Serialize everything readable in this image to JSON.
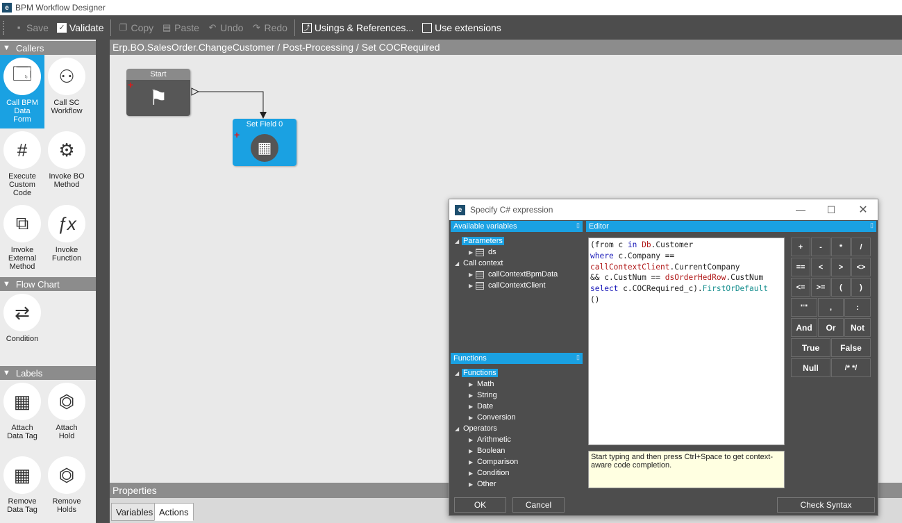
{
  "window": {
    "title": "BPM Workflow Designer",
    "logo": "e"
  },
  "toolbar": {
    "save": "Save",
    "validate": "Validate",
    "copy": "Copy",
    "paste": "Paste",
    "undo": "Undo",
    "redo": "Redo",
    "usings": "Usings & References...",
    "extensions": "Use extensions"
  },
  "toolbox": {
    "callers": {
      "header": "Callers",
      "items": [
        "Call BPM Data Form",
        "Call SC Workflow",
        "Execute Custom Code",
        "Invoke BO Method",
        "Invoke External Method",
        "Invoke Function"
      ]
    },
    "flowchart": {
      "header": "Flow Chart",
      "items": [
        "Condition"
      ]
    },
    "labels": {
      "header": "Labels",
      "items": [
        "Attach Data Tag",
        "Attach Hold",
        "Remove Data Tag",
        "Remove Holds"
      ]
    }
  },
  "breadcrumb": "Erp.BO.SalesOrder.ChangeCustomer / Post-Processing / Set COCRequired",
  "canvas": {
    "nodes": {
      "start": "Start",
      "set_field": "Set Field 0"
    }
  },
  "properties": {
    "header": "Properties",
    "tabs": [
      "Variables",
      "Actions"
    ],
    "active_tab": "Actions"
  },
  "dialog": {
    "logo": "e",
    "title": "Specify C# expression",
    "variables": {
      "header": "Available variables",
      "parameters": "Parameters",
      "ds": "ds",
      "call_context": "Call context",
      "bpm_data": "callContextBpmData",
      "client": "callContextClient"
    },
    "functions": {
      "header": "Functions",
      "root": "Functions",
      "items": [
        "Math",
        "String",
        "Date",
        "Conversion"
      ],
      "operators": "Operators",
      "operator_items": [
        "Arithmetic",
        "Boolean",
        "Comparison",
        "Condition",
        "Other"
      ]
    },
    "editor": {
      "header": "Editor",
      "code": {
        "l1": [
          "(from c ",
          "in",
          " ",
          "Db",
          ".Customer"
        ],
        "l2": [
          "where",
          " c.Company =="
        ],
        "l3": [
          "callContextClient",
          ".CurrentCompany"
        ],
        "l4": [
          "&& c.CustNum == ",
          "dsOrderHedRow",
          ".CustNum"
        ],
        "l5": [
          "select",
          " c.COCRequired_c).",
          "FirstOrDefault"
        ],
        "l6": "()"
      },
      "hint": "Start typing and then press Ctrl+Space to get context-aware code completion."
    },
    "keypad": {
      "row1": [
        "+",
        "-",
        "*",
        "/"
      ],
      "row2": [
        "==",
        "<",
        ">",
        "<>"
      ],
      "row3": [
        "<=",
        ">=",
        "(",
        ")"
      ],
      "row4": [
        "\"\"",
        ",",
        ":"
      ],
      "row5": [
        "And",
        "Or",
        "Not"
      ],
      "row6": [
        "True",
        "False"
      ],
      "row7": [
        "Null",
        "/* */"
      ]
    },
    "buttons": {
      "ok": "OK",
      "cancel": "Cancel",
      "check": "Check Syntax"
    }
  },
  "colors": {
    "accent": "#1aa1e2",
    "dark": "#4d4d4d",
    "header": "#8c8c8c"
  }
}
